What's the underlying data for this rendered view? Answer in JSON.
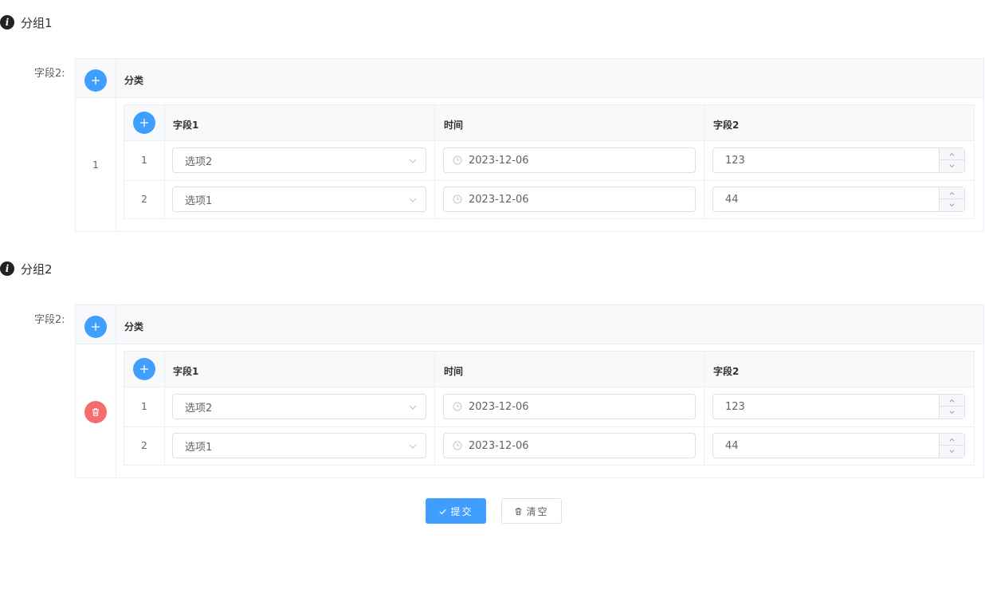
{
  "groups": [
    {
      "title": "分组1",
      "field_label": "字段2:",
      "outer_header": "分类",
      "outer_row_index": "1",
      "inner_columns": [
        "字段1",
        "时间",
        "字段2"
      ],
      "rows": [
        {
          "index": "1",
          "select": "选项2",
          "date": "2023-12-06",
          "number": "123"
        },
        {
          "index": "2",
          "select": "选项1",
          "date": "2023-12-06",
          "number": "44"
        }
      ]
    },
    {
      "title": "分组2",
      "field_label": "字段2:",
      "outer_header": "分类",
      "inner_columns": [
        "字段1",
        "时间",
        "字段2"
      ],
      "rows": [
        {
          "index": "1",
          "select": "选项2",
          "date": "2023-12-06",
          "number": "123"
        },
        {
          "index": "2",
          "select": "选项1",
          "date": "2023-12-06",
          "number": "44"
        }
      ]
    }
  ],
  "actions": {
    "submit_label": "提交",
    "clear_label": "清空"
  },
  "colors": {
    "primary": "#409eff",
    "danger": "#f56c6c",
    "border": "#ebeef5"
  }
}
